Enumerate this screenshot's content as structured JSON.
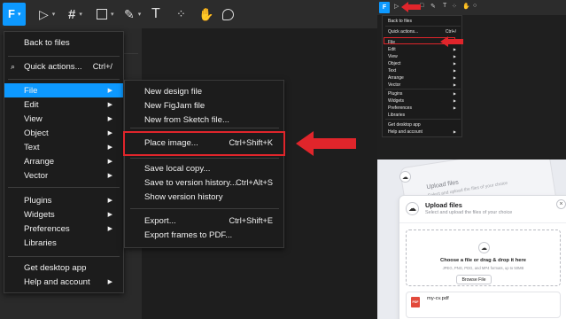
{
  "main_menu": {
    "top_items": [
      {
        "label": "Back to files"
      },
      {
        "label": "Quick actions...",
        "shortcut": "Ctrl+/"
      }
    ],
    "items_group1": [
      {
        "label": "File",
        "has_submenu": true,
        "active": true
      },
      {
        "label": "Edit",
        "has_submenu": true
      },
      {
        "label": "View",
        "has_submenu": true
      },
      {
        "label": "Object",
        "has_submenu": true
      },
      {
        "label": "Text",
        "has_submenu": true
      },
      {
        "label": "Arrange",
        "has_submenu": true
      },
      {
        "label": "Vector",
        "has_submenu": true
      }
    ],
    "items_group2": [
      {
        "label": "Plugins",
        "has_submenu": true
      },
      {
        "label": "Widgets",
        "has_submenu": true
      },
      {
        "label": "Preferences",
        "has_submenu": true
      },
      {
        "label": "Libraries",
        "has_submenu": false
      }
    ],
    "items_group3": [
      {
        "label": "Get desktop app",
        "has_submenu": false
      },
      {
        "label": "Help and account",
        "has_submenu": true
      }
    ]
  },
  "file_submenu": {
    "group1": [
      {
        "label": "New design file",
        "shortcut": ""
      },
      {
        "label": "New FigJam file",
        "shortcut": ""
      },
      {
        "label": "New from Sketch file...",
        "shortcut": ""
      }
    ],
    "group2": [
      {
        "label": "Place image...",
        "shortcut": "Ctrl+Shift+K",
        "highlighted": true
      }
    ],
    "group3": [
      {
        "label": "Save local copy...",
        "shortcut": ""
      },
      {
        "label": "Save to version history...",
        "shortcut": "Ctrl+Alt+S"
      },
      {
        "label": "Show version history",
        "shortcut": ""
      }
    ],
    "group4": [
      {
        "label": "Export...",
        "shortcut": "Ctrl+Shift+E"
      },
      {
        "label": "Export frames to PDF...",
        "shortcut": ""
      }
    ]
  },
  "mini_menu": {
    "items": [
      {
        "label": "Back to files",
        "shortcut": ""
      },
      {
        "label": "Quick actions...",
        "shortcut": "Ctrl+/"
      },
      {
        "label": "File",
        "arrow": true
      },
      {
        "label": "Edit",
        "arrow": true
      },
      {
        "label": "View",
        "arrow": true
      },
      {
        "label": "Object",
        "arrow": true
      },
      {
        "label": "Text",
        "arrow": true
      },
      {
        "label": "Arrange",
        "arrow": true
      },
      {
        "label": "Vector",
        "arrow": true
      },
      {
        "label": "Plugins",
        "arrow": true
      },
      {
        "label": "Widgets",
        "arrow": true
      },
      {
        "label": "Preferences",
        "arrow": true
      },
      {
        "label": "Libraries",
        "arrow": false
      },
      {
        "label": "Get desktop app",
        "arrow": false
      },
      {
        "label": "Help and account",
        "arrow": true
      }
    ]
  },
  "upload_dialog": {
    "ghost_title": "Upload files",
    "ghost_subtitle": "Select and upload the files of your choice",
    "title": "Upload files",
    "subtitle": "Select and upload the files of your choice",
    "dropzone_main": "Choose a file or drag & drop it here",
    "dropzone_hint": "JPEG, PNG, PDG, and MP4 formats, up to 50MB",
    "browse_label": "Browse File",
    "file_name": "my-cv.pdf",
    "file_type_badge": "PDF"
  },
  "colors": {
    "accent": "#0d99ff",
    "highlight_red": "#e0252b",
    "menu_bg": "#1c1c1c"
  },
  "icons": {
    "logo": "figma-logo-icon",
    "move": "move-pointer-icon",
    "frame": "frame-hash-icon",
    "shape": "rectangle-icon",
    "pen": "pen-icon",
    "text": "text-icon",
    "resources": "resources-icon",
    "hand": "hand-icon",
    "comment": "comment-icon"
  }
}
